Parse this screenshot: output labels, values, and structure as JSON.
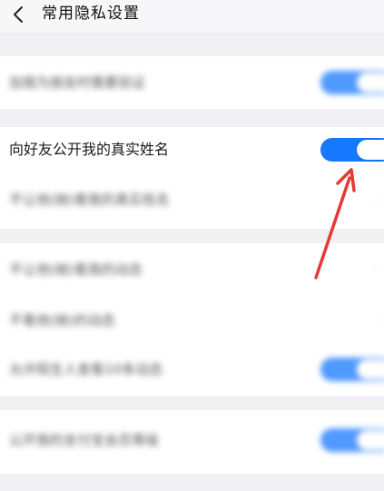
{
  "header": {
    "title": "常用隐私设置",
    "back_icon": "back-chevron-icon"
  },
  "groups": [
    {
      "items": [
        {
          "label": "加我为朋友时需要验证",
          "blurred": true,
          "control": "toggle",
          "toggle_on": true
        }
      ]
    },
    {
      "items": [
        {
          "label": "向好友公开我的真实姓名",
          "blurred": false,
          "control": "toggle",
          "toggle_on": true
        },
        {
          "label": "不让他(她)看我的真实姓名",
          "blurred": true,
          "control": "chevron"
        }
      ]
    },
    {
      "items": [
        {
          "label": "不让他(她)看我的动态",
          "blurred": true,
          "control": "chevron"
        },
        {
          "label": "不看他(她)的动态",
          "blurred": true,
          "control": "chevron"
        },
        {
          "label": "允许陌生人查看10条动态",
          "blurred": true,
          "control": "toggle",
          "toggle_on": true
        }
      ]
    },
    {
      "items": [
        {
          "label": "公开我的支付宝会员等级",
          "blurred": true,
          "control": "toggle",
          "toggle_on": true
        }
      ]
    }
  ],
  "annotation": {
    "arrow_color": "#e53935"
  },
  "colors": {
    "toggle_on": "#1677ff",
    "background": "#f1f1f4",
    "card": "#ffffff"
  }
}
